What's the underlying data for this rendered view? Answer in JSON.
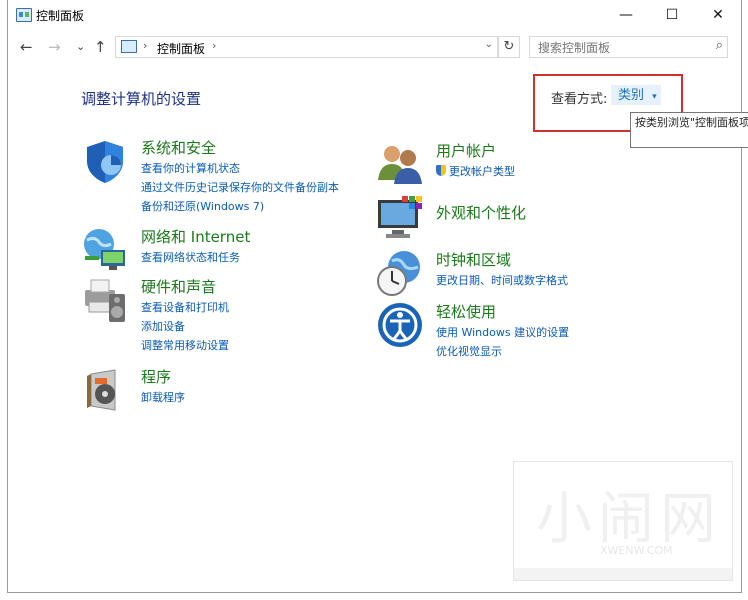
{
  "window": {
    "title": "控制面板",
    "controls": {
      "minimize": "—",
      "maximize": "☐",
      "close": "✕"
    }
  },
  "nav": {
    "back": "←",
    "forward": "→",
    "dropdown": "⌄",
    "up": "↑",
    "breadcrumb": [
      "控制面板"
    ],
    "address_dropdown": "⌄",
    "refresh": "↻",
    "search_placeholder": "搜索控制面板"
  },
  "content": {
    "heading": "调整计算机的设置",
    "view_by_label": "查看方式:",
    "view_by_value": "类别",
    "view_by_arrow": "▾",
    "tooltip": "按类别浏览\"控制面板项目的完整列表。",
    "categories_left": [
      {
        "title": "系统和安全",
        "icon": "shield-icon",
        "links": [
          "查看你的计算机状态",
          "通过文件历史记录保存你的文件备份副本",
          "备份和还原(Windows 7)"
        ]
      },
      {
        "title": "网络和 Internet",
        "icon": "network-globe-icon",
        "links": [
          "查看网络状态和任务"
        ]
      },
      {
        "title": "硬件和声音",
        "icon": "printer-speaker-icon",
        "links": [
          "查看设备和打印机",
          "添加设备",
          "调整常用移动设置"
        ]
      },
      {
        "title": "程序",
        "icon": "programs-disc-icon",
        "links": [
          "卸载程序"
        ]
      }
    ],
    "categories_right": [
      {
        "title": "用户帐户",
        "icon": "users-icon",
        "links": [
          "更改帐户类型"
        ]
      },
      {
        "title": "外观和个性化",
        "icon": "monitor-colors-icon",
        "links": []
      },
      {
        "title": "时钟和区域",
        "icon": "clock-globe-icon",
        "links": [
          "更改日期、时间或数字格式"
        ]
      },
      {
        "title": "轻松使用",
        "icon": "ease-of-access-icon",
        "links": [
          "使用 Windows 建议的设置",
          "优化视觉显示"
        ]
      }
    ]
  },
  "watermark": {
    "text": "小闹网",
    "url": "XWENW.COM"
  },
  "colors": {
    "link": "#0b5bb5",
    "category_title": "#1a7a1a",
    "heading": "#1e3287",
    "highlight_box": "#d32f2f"
  }
}
